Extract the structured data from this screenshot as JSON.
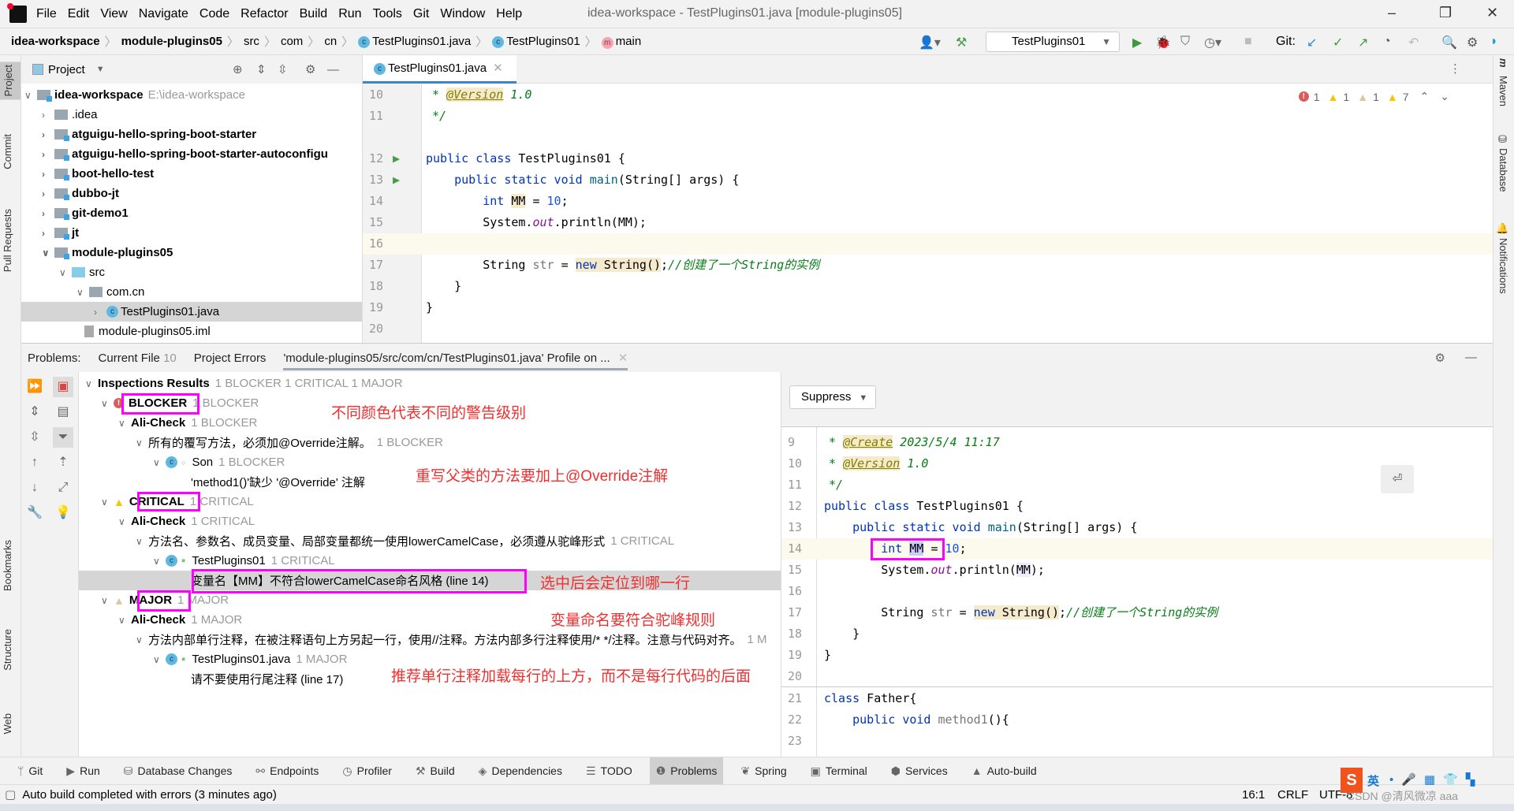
{
  "menubar": {
    "items": [
      "File",
      "Edit",
      "View",
      "Navigate",
      "Code",
      "Refactor",
      "Build",
      "Run",
      "Tools",
      "Git",
      "Window",
      "Help"
    ],
    "title": "idea-workspace - TestPlugins01.java [module-plugins05]"
  },
  "navbar": {
    "crumbs": [
      "idea-workspace",
      "module-plugins05",
      "src",
      "com",
      "cn",
      "TestPlugins01.java",
      "TestPlugins01",
      "main"
    ],
    "run_config": "TestPlugins01",
    "git_label": "Git:"
  },
  "left_strip": [
    "Project",
    "Commit",
    "Pull Requests",
    "Bookmarks",
    "Structure",
    "Web"
  ],
  "right_strip": [
    "Maven",
    "Database",
    "Notifications"
  ],
  "project": {
    "title": "Project",
    "tree": [
      {
        "label": "idea-workspace",
        "path": "E:\\idea-workspace"
      },
      {
        "label": ".idea"
      },
      {
        "label": "atguigu-hello-spring-boot-starter"
      },
      {
        "label": "atguigu-hello-spring-boot-starter-autoconfigu"
      },
      {
        "label": "boot-hello-test"
      },
      {
        "label": "dubbo-jt"
      },
      {
        "label": "git-demo1"
      },
      {
        "label": "jt"
      },
      {
        "label": "module-plugins05"
      },
      {
        "label": "src"
      },
      {
        "label": "com.cn"
      },
      {
        "label": "TestPlugins01.java"
      },
      {
        "label": "module-plugins05.iml"
      }
    ]
  },
  "editor": {
    "tab": "TestPlugins01.java",
    "inspection_counts": {
      "error": "1",
      "warning": "1",
      "weak_warning": "1",
      "typo": "7"
    },
    "line_numbers": [
      "10",
      "11",
      "12",
      "13",
      "14",
      "15",
      "16",
      "17",
      "18",
      "19",
      "20"
    ]
  },
  "problems": {
    "label": "Problems:",
    "tabs": [
      {
        "label": "Current File",
        "count": "10"
      },
      {
        "label": "Project Errors"
      },
      {
        "label": "'module-plugins05/src/com/cn/TestPlugins01.java' Profile on ..."
      }
    ],
    "tree": [
      {
        "label": "Inspections Results",
        "count": "1 BLOCKER 1 CRITICAL 1 MAJOR"
      },
      {
        "label": "BLOCKER",
        "count": "1 BLOCKER"
      },
      {
        "label": "Ali-Check",
        "count": "1 BLOCKER"
      },
      {
        "label": "所有的覆写方法，必须加@Override注解。",
        "count": "1 BLOCKER"
      },
      {
        "label": "Son",
        "count": "1 BLOCKER"
      },
      {
        "label": "'method1()'缺少 '@Override' 注解"
      },
      {
        "label": "CRITICAL",
        "count": "1 CRITICAL"
      },
      {
        "label": "Ali-Check",
        "count": "1 CRITICAL"
      },
      {
        "label": "方法名、参数名、成员变量、局部变量都统一使用lowerCamelCase，必须遵从驼峰形式",
        "count": "1 CRITICAL"
      },
      {
        "label": "TestPlugins01",
        "count": "1 CRITICAL"
      },
      {
        "label": "变量名【MM】不符合lowerCamelCase命名风格 (line 14)"
      },
      {
        "label": "MAJOR",
        "count": "1 MAJOR"
      },
      {
        "label": "Ali-Check",
        "count": "1 MAJOR"
      },
      {
        "label": "方法内部单行注释，在被注释语句上方另起一行，使用//注释。方法内部多行注释使用/* */注释。注意与代码对齐。",
        "count": "1 M"
      },
      {
        "label": "TestPlugins01.java",
        "count": "1 MAJOR"
      },
      {
        "label": "请不要使用行尾注释 (line 17)"
      }
    ],
    "annotations": [
      "不同颜色代表不同的警告级别",
      "重写父类的方法要加上@Override注解",
      "选中后会定位到哪一行",
      "变量命名要符合驼峰规则",
      "推荐单行注释加载每行的上方，而不是每行代码的后面"
    ],
    "suppress_label": "Suppress",
    "preview_line_numbers": [
      "9",
      "10",
      "11",
      "12",
      "13",
      "14",
      "15",
      "16",
      "17",
      "18",
      "19",
      "20",
      "21",
      "22",
      "23"
    ]
  },
  "toolwindows": [
    "Git",
    "Run",
    "Database Changes",
    "Endpoints",
    "Profiler",
    "Build",
    "Dependencies",
    "TODO",
    "Problems",
    "Spring",
    "Terminal",
    "Services",
    "Auto-build"
  ],
  "status": {
    "message": "Auto build completed with errors (3 minutes ago)",
    "position": "16:1",
    "line_ending": "CRLF",
    "encoding": "UTF-8",
    "watermark": "CSDN @清风微凉 aaa",
    "ime": "英"
  },
  "colors": {
    "accent": "#4083c9",
    "annotation_box": "#ff00ff",
    "annotation_text": "#f03030",
    "error": "#db5c5c",
    "warning": "#f2c600"
  }
}
